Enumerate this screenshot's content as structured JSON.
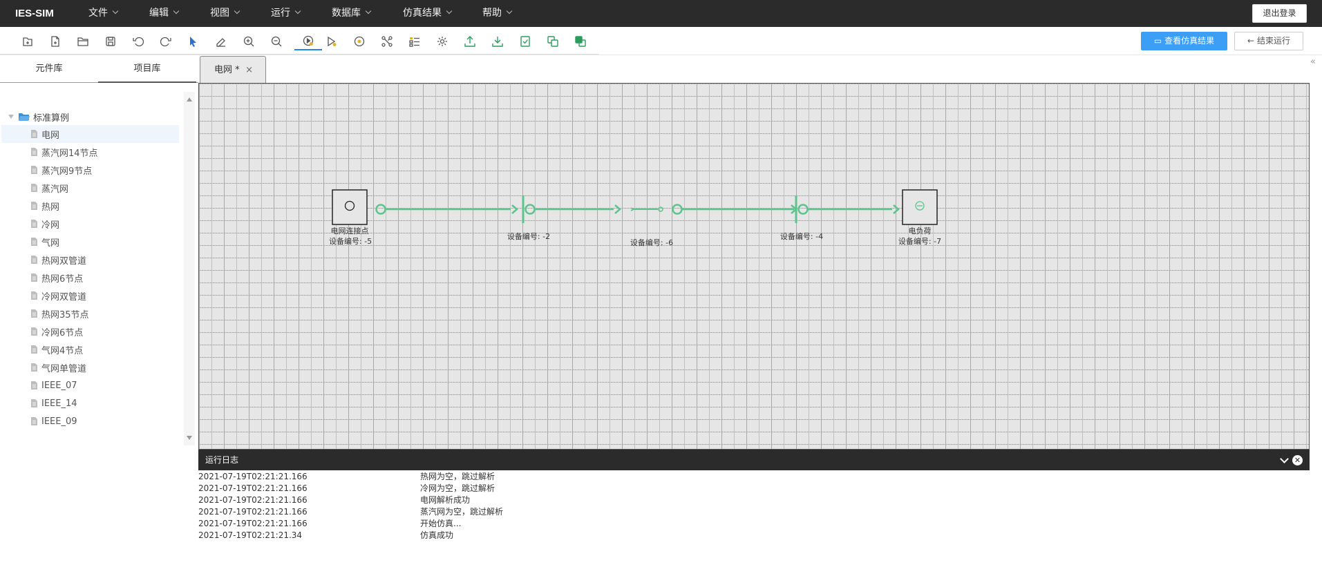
{
  "app": {
    "brand": "IES-SIM",
    "logout": "退出登录"
  },
  "menu": [
    {
      "label": "文件"
    },
    {
      "label": "编辑"
    },
    {
      "label": "视图"
    },
    {
      "label": "运行"
    },
    {
      "label": "数据库"
    },
    {
      "label": "仿真结果"
    },
    {
      "label": "帮助"
    }
  ],
  "toolbar": {
    "tools": [
      "new-file-icon",
      "new-document-icon",
      "open-folder-icon",
      "save-icon",
      "undo-icon",
      "redo-icon",
      "pointer-icon",
      "eraser-icon",
      "zoom-in-icon",
      "zoom-out-icon",
      "run-icon",
      "step-run-icon",
      "record-icon",
      "connection-icon",
      "checklist-icon",
      "settings-icon",
      "upload-icon",
      "download-icon",
      "check-document-icon",
      "copy-icon",
      "layers-icon"
    ],
    "view_results": "查看仿真结果",
    "end_run": "结束运行",
    "accent": "#3d9ef5"
  },
  "left_panel": {
    "tabs": [
      "元件库",
      "项目库"
    ],
    "active_tab": 1,
    "tree": {
      "root": "标准算例",
      "items": [
        "电网",
        "蒸汽网14节点",
        "蒸汽网9节点",
        "蒸汽网",
        "热网",
        "冷网",
        "气网",
        "热网双管道",
        "热网6节点",
        "冷网双管道",
        "热网35节点",
        "冷网6节点",
        "气网4节点",
        "气网单管道",
        "IEEE_07",
        "IEEE_14",
        "IEEE_09"
      ],
      "selected": 0
    }
  },
  "document_tab": {
    "title": "电网 *",
    "close": "×"
  },
  "diagram": {
    "line_color": "#5cc48c",
    "nodes": [
      {
        "name": "电网连接点",
        "id": "设备编号: -5"
      },
      {
        "name": "",
        "id": "设备编号: -2"
      },
      {
        "name": "",
        "id": "设备编号: -6"
      },
      {
        "name": "",
        "id": "设备编号: -4"
      },
      {
        "name": "电负荷",
        "id": "设备编号: -7"
      }
    ]
  },
  "log": {
    "title": "运行日志",
    "entries": [
      {
        "time": "2021-07-19T02:21:21.166",
        "msg": "热网为空，跳过解析"
      },
      {
        "time": "2021-07-19T02:21:21.166",
        "msg": "冷网为空，跳过解析"
      },
      {
        "time": "2021-07-19T02:21:21.166",
        "msg": "电网解析成功"
      },
      {
        "time": "2021-07-19T02:21:21.166",
        "msg": "蒸汽网为空，跳过解析"
      },
      {
        "time": "2021-07-19T02:21:21.166",
        "msg": "开始仿真..."
      },
      {
        "time": "2021-07-19T02:21:21.34",
        "msg": "仿真成功"
      }
    ]
  }
}
